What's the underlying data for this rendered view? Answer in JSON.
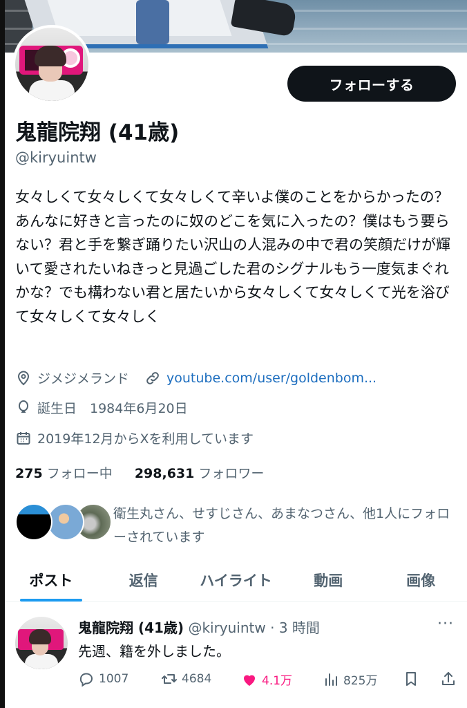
{
  "profile": {
    "name": "鬼龍院翔 (41歳)",
    "handle": "@kiryuintw",
    "follow_label": "フォローする",
    "bio": "女々しくて女々しくて女々しくて辛いよ僕のことをからかったの？あんなに好きと言ったのに奴のどこを気に入ったの？僕はもう要らない？君と手を繋ぎ踊りたい沢山の人混みの中で君の笑顔だけが輝いて愛されたいねきっと見過ごした君のシグナルもう一度気まぐれかな？でも構わない君と居たいから女々しくて女々しくて光を浴びて女々しくて女々しく",
    "location": "ジメジメランド",
    "link": "youtube.com/user/goldenbom...",
    "birthday": "誕生日　1984年6月20日",
    "joined": "2019年12月からXを利用しています",
    "following_count": "275",
    "following_label": "フォロー中",
    "followers_count": "298,631",
    "followers_label": "フォロワー",
    "followed_by": "衛生丸さん、せすじさん、あまなつさん、他1人にフォローされています"
  },
  "tabs": [
    {
      "label": "ポスト",
      "active": true
    },
    {
      "label": "返信",
      "active": false
    },
    {
      "label": "ハイライト",
      "active": false
    },
    {
      "label": "動画",
      "active": false
    },
    {
      "label": "画像",
      "active": false
    }
  ],
  "post": {
    "name": "鬼龍院翔 (41歳)",
    "handle_time": "@kiryuintw · 3 時間",
    "more": "···",
    "text": "先週、籍を外しました。",
    "replies": "1007",
    "reposts": "4684",
    "likes": "4.1万",
    "views": "825万"
  },
  "colors": {
    "accent": "#1d9bf0",
    "link": "#1d6ebf",
    "like": "#f91880",
    "button_bg": "#0f1419",
    "muted": "#536471"
  }
}
